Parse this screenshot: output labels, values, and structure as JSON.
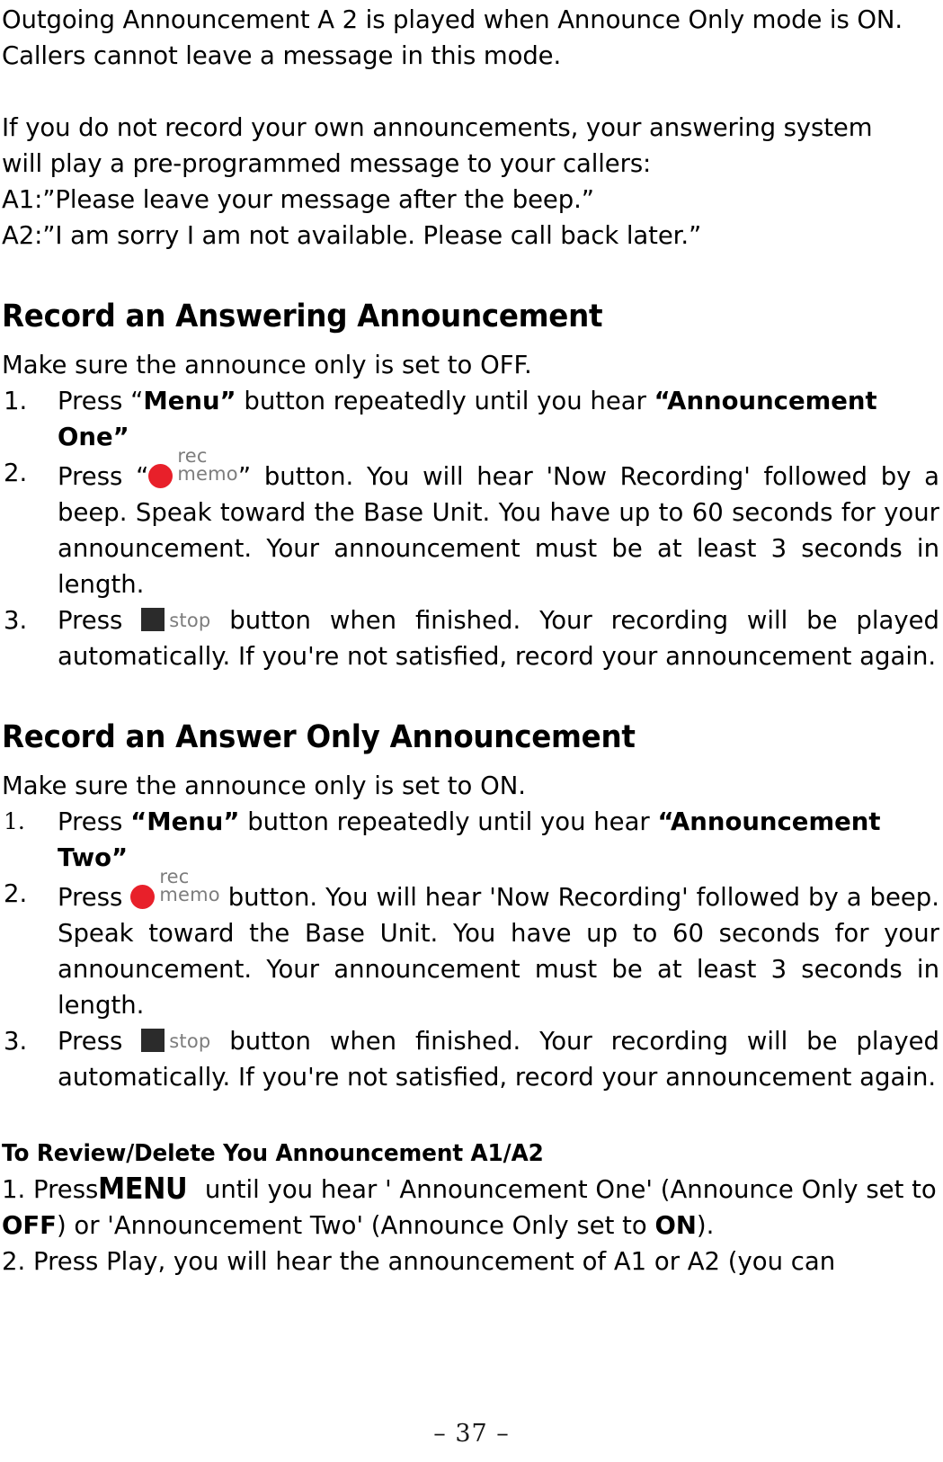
{
  "document": {
    "page_number": "– 37 –"
  },
  "intro": {
    "line1": "Outgoing Announcement A 2 is played when Announce Only mode is ON.",
    "line2": "Callers cannot leave a message in this mode.",
    "line3": "If you do not record your own announcements, your answering system",
    "line4": "will play a pre-programmed message to your callers:",
    "line5": "A1:”Please leave your message after the beep.”",
    "line6": "A2:”I am sorry I am not available. Please call back later.”"
  },
  "section_answering": {
    "title": "Record an Answering Announcement",
    "lead": "Make sure the announce only is set to OFF.",
    "steps": [
      {
        "number": "1.",
        "pre": "Press “",
        "bold1": "Menu”",
        "mid": " button repeatedly until you hear ",
        "bold2": "“Announcement One”",
        "post": ""
      },
      {
        "number": "2.",
        "pre": "Press “",
        "icon": "record-memo-icon",
        "icon_label_top": "rec",
        "icon_label_bottom": "memo",
        "post": "” button. You will hear 'Now Recording' followed by a beep. Speak toward the Base Unit. You have up to 60 seconds for your announcement. Your announcement must be at least 3 seconds in length."
      },
      {
        "number": "3.",
        "pre": "Press ",
        "icon": "stop-icon",
        "icon_label": "stop",
        "post": " button when finished. Your recording will be played automatically. If you're not satisfied, record your announcement again."
      }
    ]
  },
  "section_answer_only": {
    "title": "Record an Answer Only Announcement",
    "lead": "Make sure the announce only is set to ON.",
    "steps": [
      {
        "number": "1.",
        "pre": "Press ",
        "bold1": "“Menu”",
        "mid": " button repeatedly until you hear ",
        "bold2": "“Announcement Two”",
        "post": ""
      },
      {
        "number": "2.",
        "pre": "Press ",
        "icon": "record-memo-icon",
        "icon_label_top": "rec",
        "icon_label_bottom": "memo",
        "post": " button. You will hear 'Now Recording' followed by a beep. Speak toward the Base Unit. You have up to 60 seconds for your announcement. Your announcement must be at least 3 seconds in length."
      },
      {
        "number": "3.",
        "pre": "Press ",
        "icon": "stop-icon",
        "icon_label": "stop",
        "post": " button when finished. Your recording will be played automatically. If you're not satisfied, record your announcement again."
      }
    ]
  },
  "review_section": {
    "heading": "To Review/Delete You Announcement A1/A2",
    "step1_pre": "1. Press",
    "step1_menu": "MENU",
    "step1_mid": " until you hear ' Announcement One' (Announce Only set to ",
    "step1_off": "OFF",
    "step1_mid2": ") or 'Announcement Two' (Announce Only set to ",
    "step1_on": "ON",
    "step1_end": ").",
    "step2": "2. Press Play, you will hear the announcement of A1 or A2 (you can"
  }
}
